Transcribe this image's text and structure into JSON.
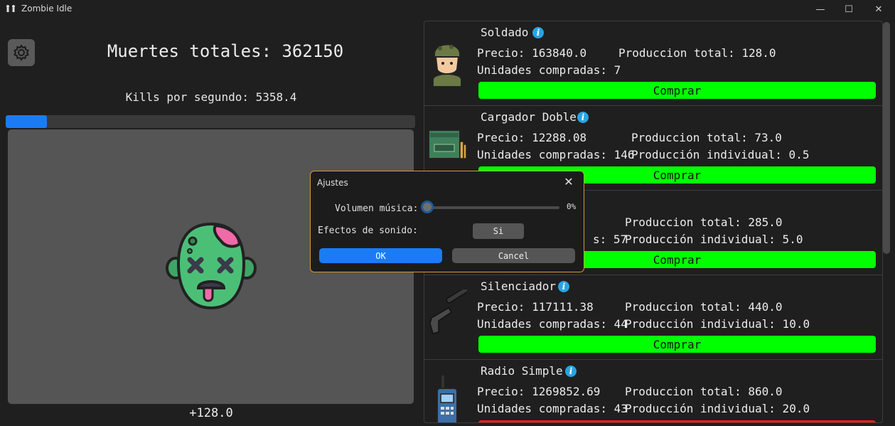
{
  "window": {
    "title": "Zombie Idle",
    "minimize": "—",
    "maximize": "☐",
    "close": "✕"
  },
  "main": {
    "total_kills": "Muertes totales: 362150",
    "kills_per_second": "Kills por segundo: 5358.4",
    "progress_fraction": 0.1,
    "last_gain": "+128.0"
  },
  "shop": {
    "items": [
      {
        "name": "Soldado",
        "price": "Precio: 163840.0",
        "production_total": "Produccion total: 128.0",
        "units": "Unidades compradas: 7",
        "individual": "",
        "buy": "Comprar",
        "icon": "soldier-icon"
      },
      {
        "name": "Cargador Doble",
        "price": "Precio: 12288.08",
        "production_total": "Produccion total: 73.0",
        "units": "Unidades compradas: 146",
        "individual": "Producción individual: 0.5",
        "buy": "Comprar",
        "icon": "ammo-box-icon"
      },
      {
        "name": "",
        "price": "",
        "production_total": "Produccion total: 285.0",
        "units": "s: 57",
        "individual": "Producción individual: 5.0",
        "buy": "Comprar",
        "icon": ""
      },
      {
        "name": "Silenciador",
        "price": "Precio: 117111.38",
        "production_total": "Produccion total: 440.0",
        "units": "Unidades compradas: 44",
        "individual": "Producción individual: 10.0",
        "buy": "Comprar",
        "icon": "silenced-pistol-icon"
      },
      {
        "name": "Radio Simple",
        "price": "Precio: 1269852.69",
        "production_total": "Produccion total: 860.0",
        "units": "Unidades compradas: 43",
        "individual": "Producción individual: 20.0",
        "buy": "",
        "icon": "walkie-talkie-icon"
      }
    ]
  },
  "settings_dialog": {
    "title": "Ajustes",
    "music_volume_label": "Volumen música:",
    "music_volume_value": "0%",
    "music_volume_fraction": 0.0,
    "sound_effects_label": "Efectos de sonido:",
    "sound_effects_value": "Si",
    "ok": "OK",
    "cancel": "Cancel"
  },
  "colors": {
    "accent": "#1a7cf5",
    "buy_button": "#00ff00",
    "dialog_border": "#d59a2b",
    "info_icon": "#2aa3e0"
  }
}
